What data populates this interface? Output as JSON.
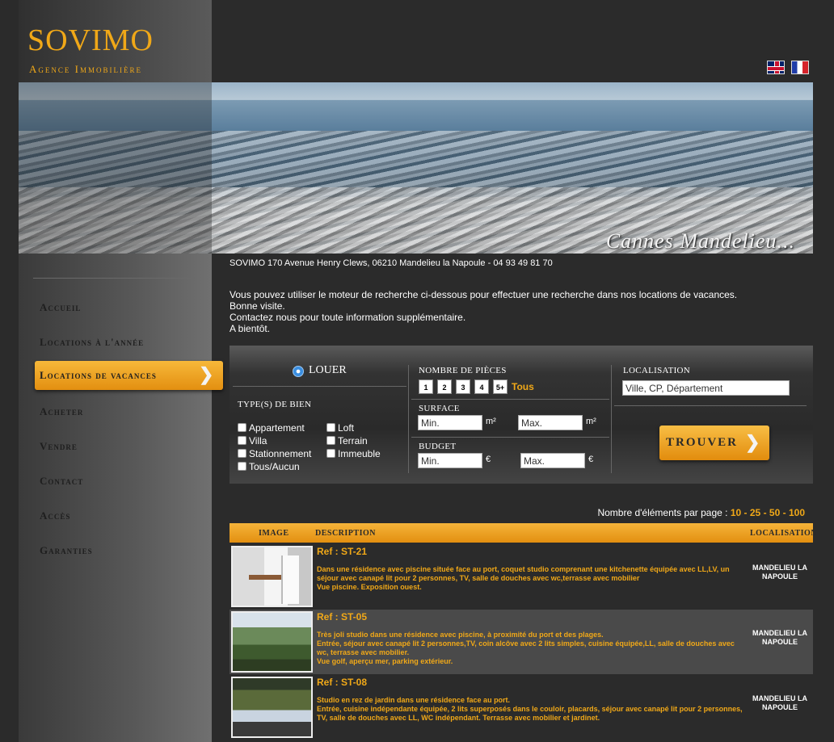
{
  "brand": {
    "name": "SOVIMO",
    "tagline": "Agence Immobilière"
  },
  "banner": {
    "caption": "Cannes Mandelieu..."
  },
  "languages": [
    {
      "name": "english-flag-icon"
    },
    {
      "name": "french-flag-icon"
    }
  ],
  "nav": {
    "items": [
      {
        "label": "Accueil"
      },
      {
        "label": "Locations à l'année"
      },
      {
        "label": "Locations de vacances",
        "active": true
      },
      {
        "label": "Acheter"
      },
      {
        "label": "Vendre"
      },
      {
        "label": "Contact"
      },
      {
        "label": "Accès"
      },
      {
        "label": "Garanties"
      }
    ]
  },
  "address": "SOVIMO 170 Avenue Henry Clews, 06210 Mandelieu la Napoule - 04 93 49 81 70",
  "intro": {
    "line1": "Vous pouvez utiliser le moteur de recherche ci-dessous pour effectuer une recherche dans nos locations de vacances.",
    "line2": "Bonne visite.",
    "line3": "Contactez nous pour toute information supplémentaire.",
    "line4": "A bientôt."
  },
  "search": {
    "mode_label": "LOUER",
    "types_title": "TYPE(S) DE BIEN",
    "types": [
      "Appartement",
      "Villa",
      "Stationnement",
      "Tous/Aucun",
      "Loft",
      "Terrain",
      "Immeuble"
    ],
    "rooms_title": "NOMBRE DE PIÈCES",
    "rooms": [
      "1",
      "2",
      "3",
      "4",
      "5+"
    ],
    "rooms_all": "Tous",
    "surface_title": "SURFACE",
    "surface_min": "Min.",
    "surface_max": "Max.",
    "surface_unit": "m²",
    "budget_title": "BUDGET",
    "budget_min": "Min.",
    "budget_max": "Max.",
    "budget_unit": "€",
    "location_title": "LOCALISATION",
    "location_value": "Ville, CP, Département",
    "submit_label": "TROUVER"
  },
  "paging": {
    "label": "Nombre d'éléments par page :",
    "options": [
      "10",
      "25",
      "50",
      "100"
    ]
  },
  "table": {
    "headers": {
      "image": "IMAGE",
      "description": "DESCRIPTION",
      "location": "LOCALISATION"
    },
    "rows": [
      {
        "ref": "Ref : ST-21",
        "description": "Dans une résidence avec piscine située face au port, coquet studio comprenant une kitchenette équipée avec LL,LV, un séjour avec canapé lit pour 2 personnes, TV, salle de douches avec wc,terrasse avec mobilier\nVue piscine. Exposition ouest.",
        "location": "MANDELIEU LA NAPOULE"
      },
      {
        "ref": "Ref : ST-05",
        "description": "Très joli studio dans une résidence avec piscine, à proximité du port et des plages.\nEntrée, séjour avec canapé lit 2 personnes,TV, coin alcôve avec 2 lits simples, cuisine équipée,LL, salle de douches avec wc, terrasse avec mobilier.\nVue golf, aperçu mer, parking extérieur.",
        "location": "MANDELIEU LA NAPOULE"
      },
      {
        "ref": "Ref : ST-08",
        "description": "Studio en rez de jardin dans une résidence face au port.\nEntrée, cuisine indépendante équipée, 2 lits superposés dans le couloir, placards, séjour avec canapé lit pour 2 personnes, TV, salle de douches avec LL, WC indépendant. Terrasse avec mobilier et jardinet.",
        "location": "MANDELIEU LA NAPOULE"
      }
    ]
  }
}
